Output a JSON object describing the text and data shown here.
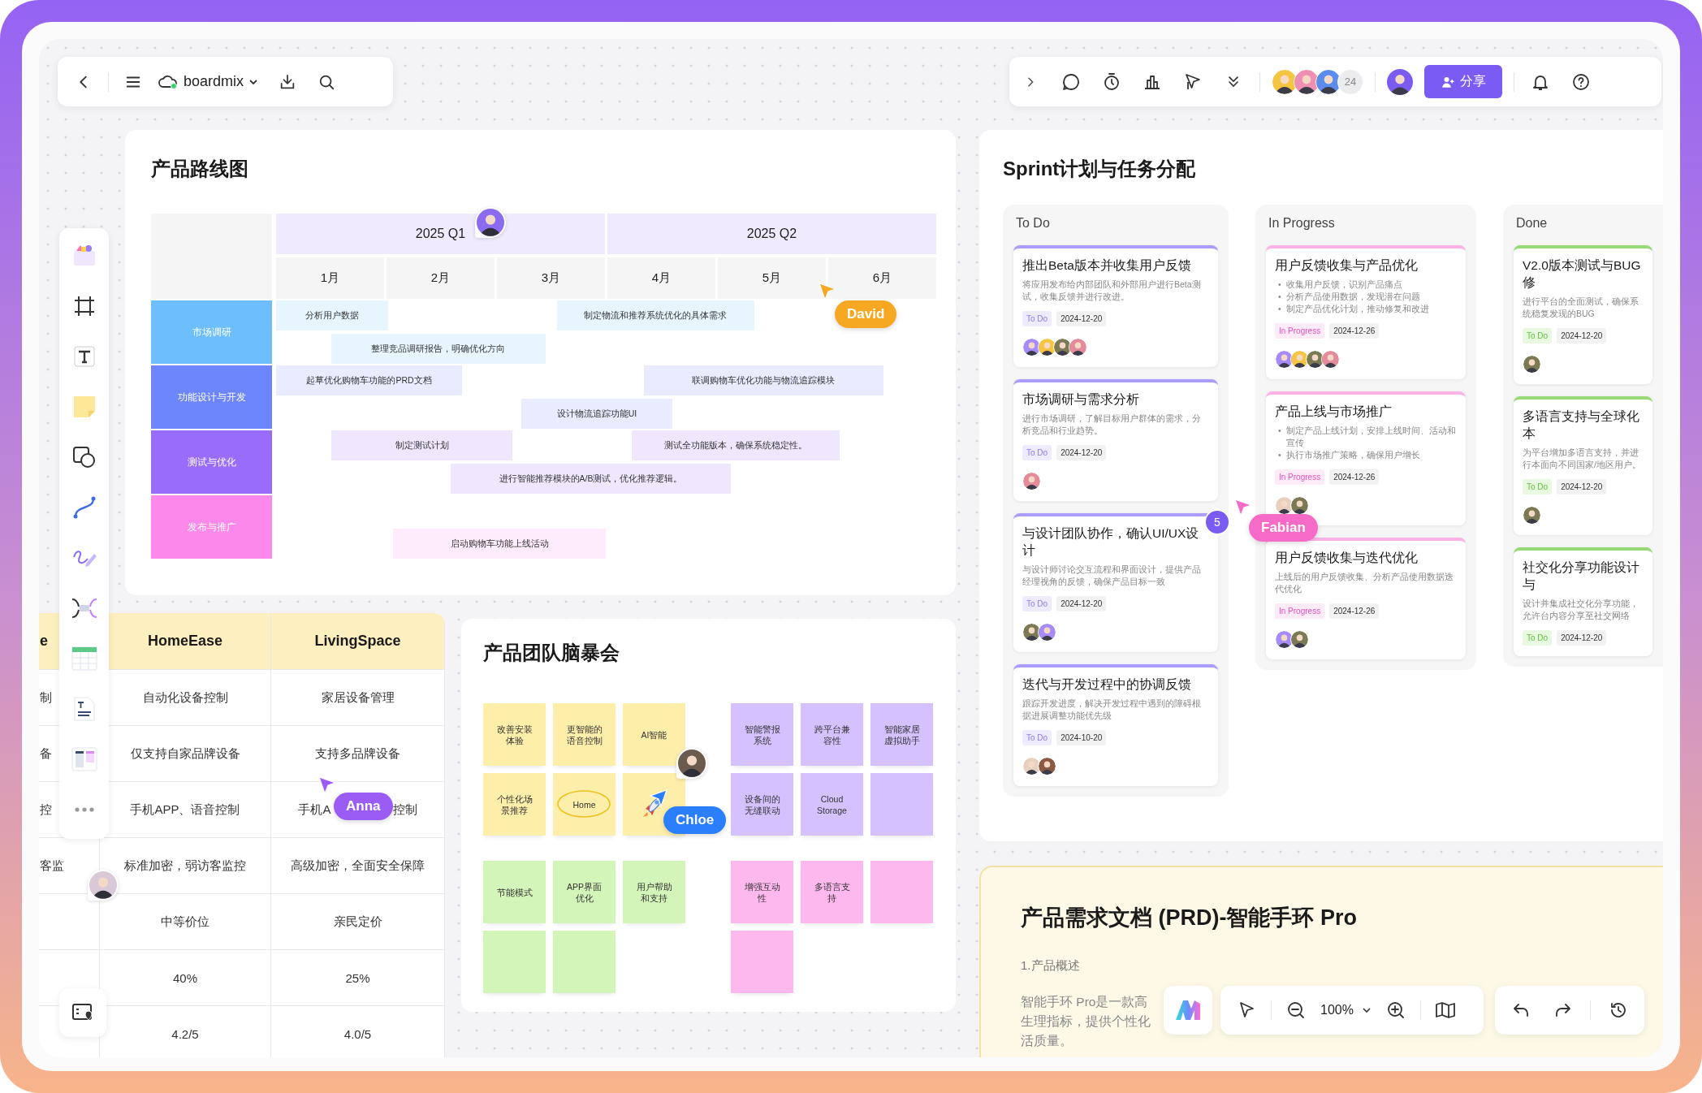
{
  "top_bar": {
    "board_name": "boardmix"
  },
  "collaborators": {
    "avatars": [
      {
        "color": "#f5c542"
      },
      {
        "color": "#f08fb4"
      },
      {
        "color": "#5b8def"
      }
    ],
    "count": "24",
    "me": {
      "color": "#7c5cf0"
    },
    "share_label": "分享"
  },
  "roadmap": {
    "title": "产品路线图",
    "quarters": [
      "2025 Q1",
      "2025 Q2"
    ],
    "months": [
      "1月",
      "2月",
      "3月",
      "4月",
      "5月",
      "6月"
    ],
    "lanes": [
      {
        "label": "市场调研",
        "color": "#6cbefc",
        "tasks": [
          "分析用户数据",
          "制定物流和推荐系统优化的具体需求",
          "整理竞品调研报告，明确优化方向"
        ]
      },
      {
        "label": "功能设计与开发",
        "color": "#6d86fb",
        "tasks": [
          "起草优化购物车功能的PRD文档",
          "联调购物车优化功能与物流追踪模块",
          "设计物流追踪功能UI"
        ]
      },
      {
        "label": "测试与优化",
        "color": "#9a6cfb",
        "tasks": [
          "制定测试计划",
          "测试全功能版本，确保系统稳定性。",
          "进行智能推荐模块的A/B测试，优化推荐逻辑。"
        ]
      },
      {
        "label": "发布与推广",
        "color": "#fb88ea",
        "tasks": [
          "启动购物车功能上线活动"
        ]
      }
    ]
  },
  "sprint": {
    "title": "Sprint计划与任务分配",
    "bullet": "•",
    "columns": [
      {
        "title": "To Do",
        "kind": "todo",
        "cards": [
          {
            "title": "推出Beta版本并收集用户反馈",
            "description": "将应用发布给内部团队和外部用户进行Beta测试，收集反馈并进行改进。",
            "tag": "To Do",
            "date": "2024-12-20",
            "assignees": [
              {
                "color": "#a78bfa"
              },
              {
                "color": "#f5c542"
              },
              {
                "color": "#7c7a55"
              },
              {
                "color": "#e58a9a"
              }
            ]
          },
          {
            "title": "市场调研与需求分析",
            "description": "进行市场调研，了解目标用户群体的需求，分析竞品和行业趋势。",
            "tag": "To Do",
            "date": "2024-12-20",
            "assignees": [
              {
                "color": "#e58a9a"
              }
            ]
          },
          {
            "title": "与设计团队协作，确认UI/UX设计",
            "description": "与设计师讨论交互流程和界面设计，提供产品经理视角的反馈，确保产品目标一致",
            "tag": "To Do",
            "date": "2024-12-20",
            "assignees": [
              {
                "color": "#7c7a55"
              },
              {
                "color": "#a78bfa"
              }
            ]
          },
          {
            "title": "迭代与开发过程中的协调反馈",
            "description": "跟踪开发进度，解决开发过程中遇到的障碍根据进展调整功能优先级",
            "tag": "To Do",
            "date": "2024-10-20",
            "assignees": [
              {
                "color": "#e8d0c0"
              },
              {
                "color": "#8a5a44"
              }
            ]
          }
        ]
      },
      {
        "title": "In Progress",
        "kind": "progress",
        "cards": [
          {
            "title": "用户反馈收集与产品优化",
            "bullets": [
              "收集用户反馈，识别产品痛点",
              "分析产品使用数据，发现潜在问题",
              "制定产品优化计划，推动修复和改进"
            ],
            "tag": "In Progress",
            "date": "2024-12-26",
            "assignees": [
              {
                "color": "#a78bfa"
              },
              {
                "color": "#f5c542"
              },
              {
                "color": "#7c7a55"
              },
              {
                "color": "#e58a9a"
              }
            ]
          },
          {
            "title": "产品上线与市场推广",
            "bullets": [
              "制定产品上线计划，安排上线时间、活动和宣传",
              "执行市场推广策略，确保用户增长"
            ],
            "tag": "In Progress",
            "date": "2024-12-26",
            "assignees": [
              {
                "color": "#e8d0c0"
              },
              {
                "color": "#7c7a55"
              }
            ]
          },
          {
            "title": "用户反馈收集与迭代优化",
            "description": "上线后的用户反馈收集、分析产品使用数据迭代优化",
            "tag": "In Progress",
            "date": "2024-12-26",
            "assignees": [
              {
                "color": "#a78bfa"
              },
              {
                "color": "#7c7a55"
              }
            ]
          }
        ]
      },
      {
        "title": "Done",
        "kind": "done",
        "cards": [
          {
            "title": "V2.0版本测试与BUG修",
            "description": "进行平台的全面测试，确保系统稳复发现的BUG",
            "tag": "To Do",
            "date": "2024-12-20",
            "assignees": [
              {
                "color": "#7c7a55"
              }
            ]
          },
          {
            "title": "多语言支持与全球化本",
            "description": "为平台增加多语言支持，并进行本面向不同国家/地区用户。",
            "tag": "To Do",
            "date": "2024-12-20",
            "assignees": [
              {
                "color": "#7c7a55"
              }
            ]
          },
          {
            "title": "社交化分享功能设计与",
            "description": "设计并集成社交化分享功能，允许台内容分享至社交网络",
            "tag": "To Do",
            "date": "2024-12-20"
          }
        ]
      }
    ]
  },
  "comparison_table": {
    "header": [
      "e",
      "HomeEase",
      "LivingSpace"
    ],
    "rows": [
      {
        "lead": "制",
        "cells": [
          "自动化设备控制",
          "家居设备管理"
        ]
      },
      {
        "lead": "备",
        "cells": [
          "仅支持自家品牌设备",
          "支持多品牌设备"
        ]
      },
      {
        "lead": "控",
        "cells": [
          "手机APP、语音控制",
          [
            "手机A",
            "控制"
          ]
        ]
      },
      {
        "lead": "客监",
        "cells": [
          "标准加密，弱访客监控",
          "高级加密，全面安全保障"
        ]
      },
      {
        "cells": [
          "中等价位",
          "亲民定价"
        ]
      },
      {
        "cells": [
          "40%",
          "25%"
        ]
      },
      {
        "cells": [
          "4.2/5",
          "4.0/5"
        ]
      }
    ]
  },
  "brainstorm": {
    "title": "产品团队脑暴会",
    "groups": [
      {
        "color": "#fdeeaa",
        "notes": [
          {
            "kind": "text",
            "text": "改善安装体验"
          },
          {
            "kind": "text",
            "text": "更智能的语音控制"
          },
          {
            "kind": "text",
            "text": "AI智能"
          },
          {
            "kind": "text",
            "text": "个性化场景推荐"
          },
          {
            "kind": "circled",
            "text": "Home"
          },
          {
            "kind": "sticker"
          }
        ]
      },
      {
        "color": "#d4c1fd",
        "notes": [
          {
            "kind": "text",
            "text": "智能警报系统"
          },
          {
            "kind": "text",
            "text": "跨平台兼容性"
          },
          {
            "kind": "text",
            "text": "智能家居虚拟助手"
          },
          {
            "kind": "text",
            "text": "设备间的无缝联动"
          },
          {
            "kind": "text",
            "text": "Cloud Storage"
          },
          {
            "kind": "blank"
          }
        ]
      },
      {
        "color": "#d4f5b9",
        "notes": [
          {
            "kind": "text",
            "text": "节能模式"
          },
          {
            "kind": "text",
            "text": "APP界面优化"
          },
          {
            "kind": "text",
            "text": "用户帮助和支持"
          },
          {
            "kind": "blank"
          },
          {
            "kind": "blank"
          }
        ]
      },
      {
        "color": "#fdb8ee",
        "notes": [
          {
            "kind": "text",
            "text": "增强互动性"
          },
          {
            "kind": "text",
            "text": "多语言支持"
          },
          {
            "kind": "blank"
          },
          {
            "kind": "blank"
          }
        ]
      }
    ]
  },
  "prd": {
    "title": "产品需求文档 (PRD)-智能手环 Pro",
    "section": "1.产品概述",
    "lines": [
      "智能手环 Pro是一款高",
      "生理指标，提供个性化",
      "活质量。"
    ]
  },
  "zoom_label": "100%",
  "count_badge": "5",
  "cursors": [
    {
      "name": "David",
      "color": "#f7a823"
    },
    {
      "name": "Anna",
      "color": "#9b5cf6"
    },
    {
      "name": "Chloe",
      "color": "#2b7fff"
    },
    {
      "name": "Fabian",
      "color": "#f76bc8"
    }
  ]
}
